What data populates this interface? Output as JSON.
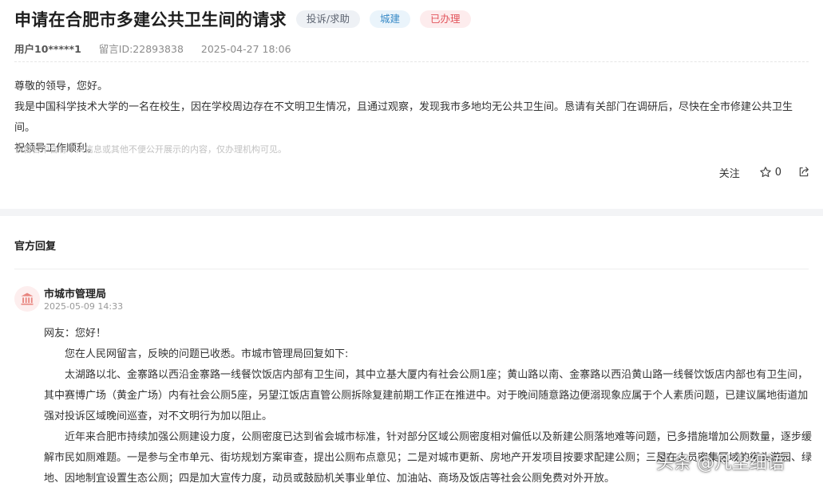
{
  "post": {
    "title": "申请在合肥市多建公共卫生间的请求",
    "tags": [
      "投诉/求助",
      "城建",
      "已办理"
    ],
    "user": "用户10*****1",
    "message_id": "留言ID:22893838",
    "datetime": "2025-04-27 18:06",
    "content": [
      "尊敬的领导，您好。",
      "我是中国科学技术大学的一名在校生，因在学校周边存在不文明卫生情况，且通过观察，发现我市多地均无公共卫生间。恳请有关部门在调研后，尽快在全市修建公共卫生间。",
      "祝领导工作顺利。"
    ],
    "notice": "该留言中含有个人信息或其他不便公开展示的内容，仅办理机构可见。",
    "actions": {
      "follow": "关注",
      "likes": "0"
    }
  },
  "reply": {
    "heading": "官方回复",
    "org": "市城市管理局",
    "date": "2025-05-09 14:33",
    "paragraphs": [
      "网友：您好！",
      "您在人民网留言，反映的问题已收悉。市城市管理局回复如下:",
      "太湖路以北、金寨路以西沿金寨路一线餐饮饭店内部有卫生间，其中立基大厦内有社会公厕1座；黄山路以南、金寨路以西沿黄山路一线餐饮饭店内部也有卫生间，其中赛博广场（黄金广场）内有社会公厕5座，另望江饭店直管公厕拆除复建前期工作正在推进中。对于晚间随意路边便溺现象应属于个人素质问题，已建议属地街道加强对投诉区域晚间巡查，对不文明行为加以阻止。",
      "近年来合肥市持续加强公厕建设力度，公厕密度已达到省会城市标准，针对部分区域公厕密度相对偏低以及新建公厕落地难等问题，已多措施增加公厕数量，逐步缓解市民如厕难题。一是参与全市单元、街坊规划方案审查，提出公厕布点意见；二是对城市更新、房地产开发项目按要求配建公厕；三是在人员密集区域的街头游园、绿地、因地制宜设置生态公厕；四是加大宣传力度，动员或鼓励机关事业单位、加油站、商场及饭店等社会公厕免费对外开放。"
    ]
  },
  "watermark": "头条 @凡尘细语",
  "icons": {
    "star": "star-outline-icon",
    "share": "share-icon",
    "avatar": "government-building-icon"
  },
  "colors": {
    "tag_gray_bg": "#eef1f5",
    "tag_blue_text": "#3a8bc7",
    "tag_red_text": "#e2545b",
    "avatar_bg": "#fdeeee",
    "avatar_icon": "#e8857f"
  }
}
